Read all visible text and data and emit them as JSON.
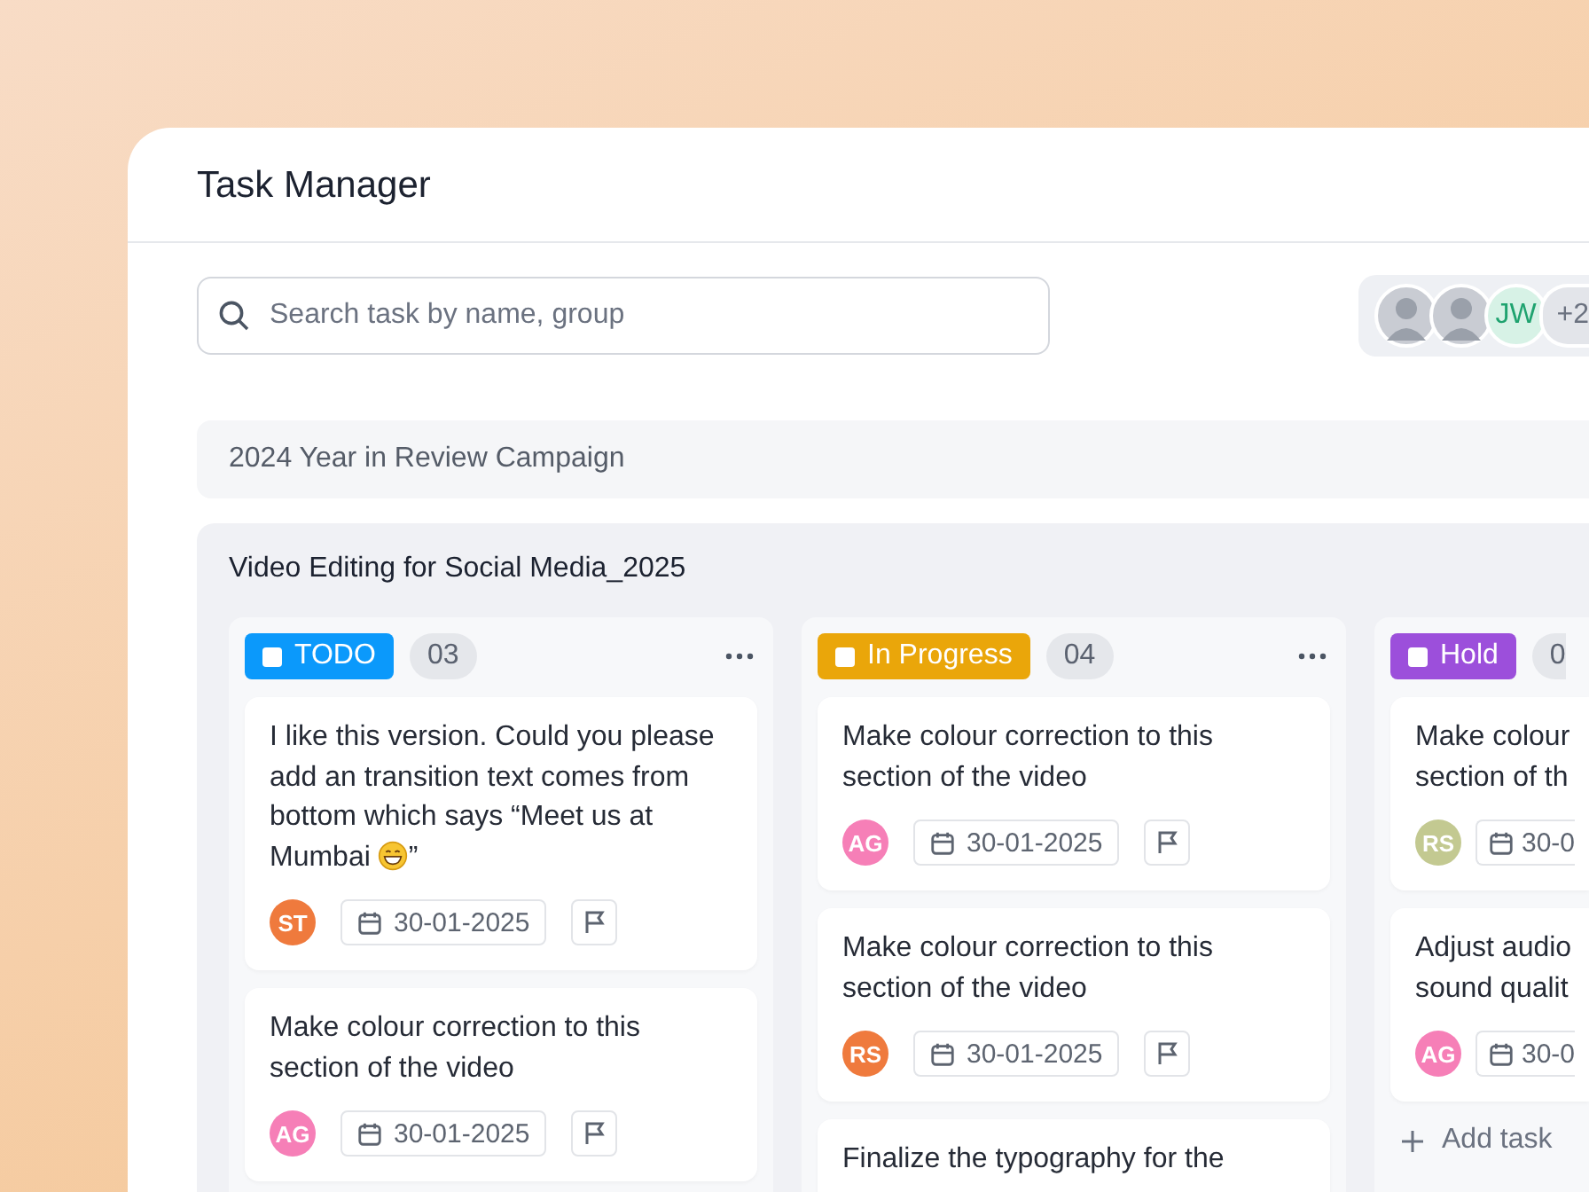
{
  "window": {
    "title": "Task Manager"
  },
  "search": {
    "placeholder": "Search task by name, group"
  },
  "members": [
    {
      "kind": "photo"
    },
    {
      "kind": "photo"
    },
    {
      "kind": "initials",
      "initials": "JW",
      "color": "#d7f2e6"
    }
  ],
  "members_more": "+2",
  "groups": [
    {
      "title": "2024 Year in Review Campaign",
      "expanded": false
    },
    {
      "title": "Video Editing for Social Media_2025",
      "expanded": true,
      "columns": [
        {
          "label": "TODO",
          "color": "#0b99fb",
          "count": "03",
          "menu": true,
          "cards": [
            {
              "text": "I like this version. Could you please add an transition text comes from bottom which says “Meet us at Mumbai",
              "emoji": true,
              "text_after": "”",
              "assignee": {
                "initials": "ST",
                "color": "#ef7a3d"
              },
              "date": "30-01-2025"
            },
            {
              "text": "Make colour correction to this section of the video",
              "assignee": {
                "initials": "AG",
                "color": "#f67fb7"
              },
              "date": "30-01-2025"
            }
          ]
        },
        {
          "label": "In Progress",
          "color": "#eaa60a",
          "count": "04",
          "menu": true,
          "cards": [
            {
              "text": "Make colour correction to this section of the video",
              "assignee": {
                "initials": "AG",
                "color": "#f67fb7"
              },
              "date": "30-01-2025"
            },
            {
              "text": "Make colour correction to this section of the video",
              "assignee": {
                "initials": "RS",
                "color": "#ef7a3d"
              },
              "date": "30-01-2025"
            },
            {
              "text": "Finalize the typography for the"
            }
          ]
        },
        {
          "label": "Hold",
          "color": "#9c4fdb",
          "count": "0",
          "menu": false,
          "cards": [
            {
              "text": "Make colour section of th",
              "assignee": {
                "initials": "RS",
                "color": "#c3c991"
              },
              "date": "30-0"
            },
            {
              "text": "Adjust audio sound qualit",
              "assignee": {
                "initials": "AG",
                "color": "#f67fb7"
              },
              "date": "30-0"
            }
          ],
          "add_task": "Add task"
        }
      ]
    }
  ]
}
